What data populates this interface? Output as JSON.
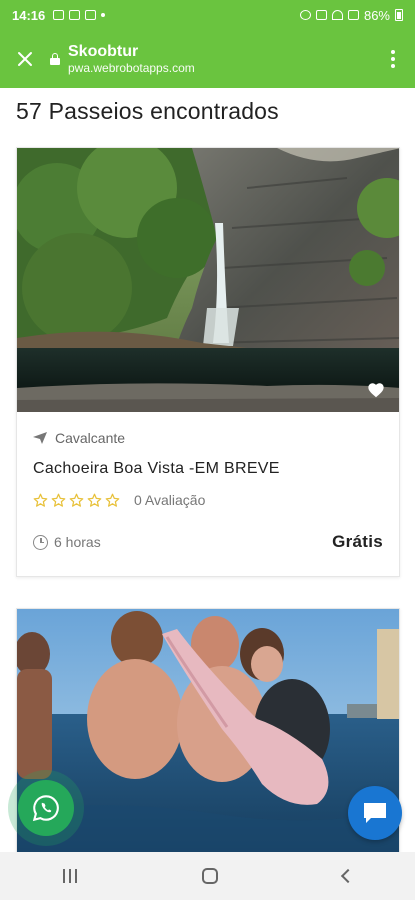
{
  "status_bar": {
    "time": "14:16",
    "battery": "86%"
  },
  "browser": {
    "title": "Skoobtur",
    "url": "pwa.webrobotapps.com"
  },
  "results": {
    "heading": "57 Passeios encontrados"
  },
  "tours": [
    {
      "location": "Cavalcante",
      "name": "Cachoeira Boa Vista -EM BREVE",
      "rating": 0,
      "reviews_label": "0 Avaliação",
      "duration": "6 horas",
      "price": "Grátis"
    }
  ],
  "colors": {
    "brand_green": "#6ac43f",
    "star": "#e8c13a",
    "whatsapp": "#25a85a",
    "chat": "#1976d2"
  },
  "icons": {
    "close": "close-icon",
    "lock": "lock-icon",
    "menu": "more-vertical-icon",
    "heart": "heart-icon",
    "location": "send-icon",
    "clock": "clock-icon",
    "whatsapp": "whatsapp-icon",
    "chat": "chat-bubble-icon"
  }
}
